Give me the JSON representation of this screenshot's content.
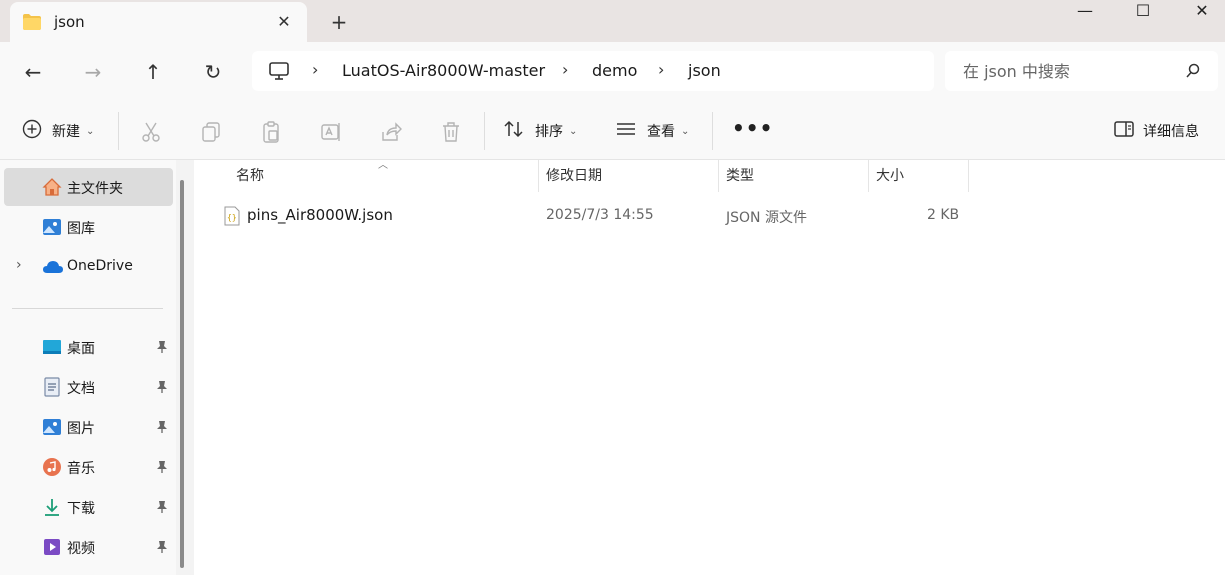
{
  "window": {
    "tab_title": "json",
    "tab_close": "✕",
    "new_tab": "+",
    "minimize": "—",
    "maximize": "☐",
    "close": "✕"
  },
  "nav": {
    "back": "←",
    "forward": "→",
    "up": "↑",
    "refresh": "↻",
    "breadcrumbs": [
      "LuatOS-Air8000W-master",
      "demo",
      "json"
    ],
    "separator": "›",
    "search_placeholder": "在 json 中搜索"
  },
  "toolbar": {
    "new_label": "新建",
    "sort_label": "排序",
    "view_label": "查看",
    "more_label": "•••",
    "details_label": "详细信息"
  },
  "sidebar": {
    "items": [
      {
        "label": "主文件夹",
        "icon": "home-icon"
      },
      {
        "label": "图库",
        "icon": "gallery-icon"
      },
      {
        "label": "OneDrive",
        "icon": "cloud-icon"
      },
      {
        "label": "桌面",
        "icon": "desktop-icon"
      },
      {
        "label": "文档",
        "icon": "document-icon"
      },
      {
        "label": "图片",
        "icon": "pictures-icon"
      },
      {
        "label": "音乐",
        "icon": "music-icon"
      },
      {
        "label": "下载",
        "icon": "download-icon"
      },
      {
        "label": "视频",
        "icon": "video-icon"
      }
    ]
  },
  "table": {
    "columns": [
      "名称",
      "修改日期",
      "类型",
      "大小"
    ],
    "rows": [
      {
        "name": "pins_Air8000W.json",
        "modified": "2025/7/3 14:55",
        "type": "JSON 源文件",
        "size": "2 KB"
      }
    ]
  },
  "colors": {
    "accent": "#0067c0",
    "folder": "#f4c34a",
    "selected": "#dcdcdc"
  }
}
